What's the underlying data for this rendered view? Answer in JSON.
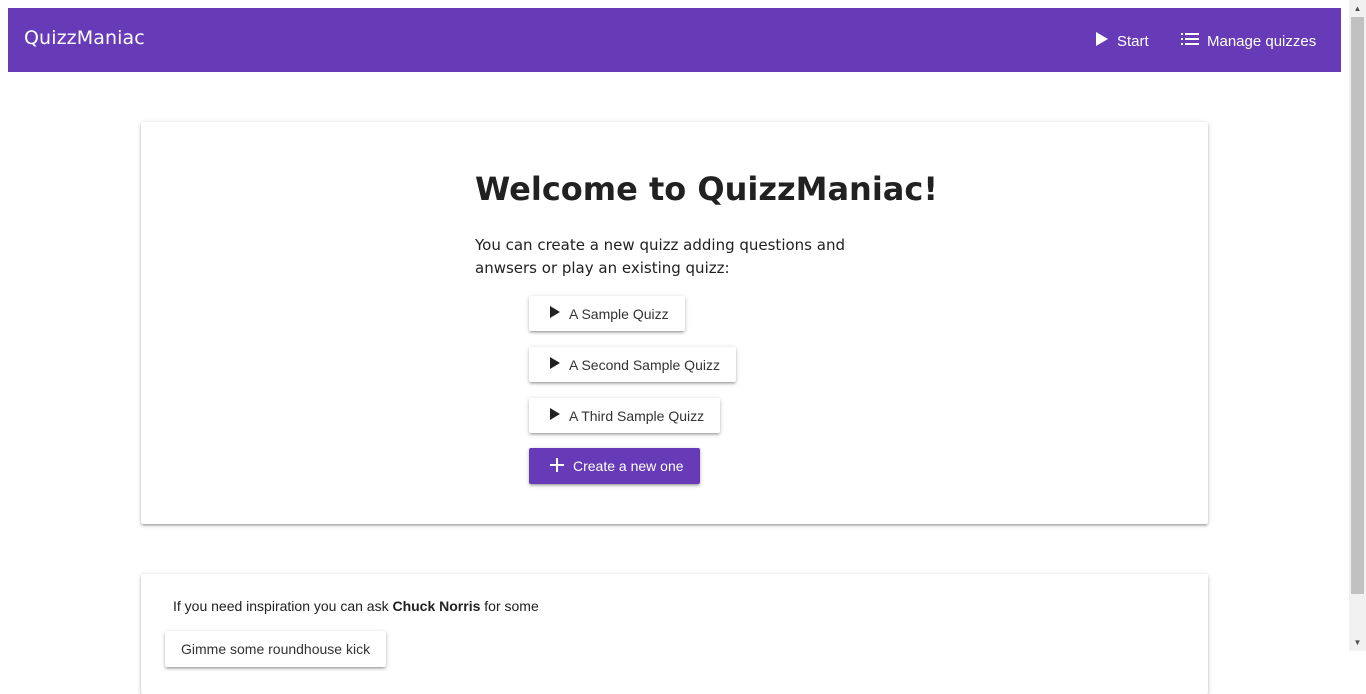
{
  "app": {
    "brand": "QuizzManiac"
  },
  "nav": {
    "start_label": "Start",
    "manage_label": "Manage quizzes"
  },
  "welcome": {
    "title": "Welcome to QuizzManiac!",
    "intro": "You can create a new quizz adding questions and anwsers or play an existing quizz:"
  },
  "quizzes": [
    {
      "label": "A Sample Quizz"
    },
    {
      "label": "A Second Sample Quizz"
    },
    {
      "label": "A Third Sample Quizz"
    }
  ],
  "create": {
    "label": "Create a new one"
  },
  "chuck": {
    "text_before": "If you need inspiration you can ask ",
    "name": "Chuck Norris",
    "text_after": " for some",
    "button_label": "Gimme some roundhouse kick"
  },
  "icons": {
    "start": "play-icon",
    "manage": "list-icon",
    "quiz": "play-icon",
    "create": "plus-icon"
  },
  "colors": {
    "primary": "#673ab7",
    "text": "#212121"
  }
}
